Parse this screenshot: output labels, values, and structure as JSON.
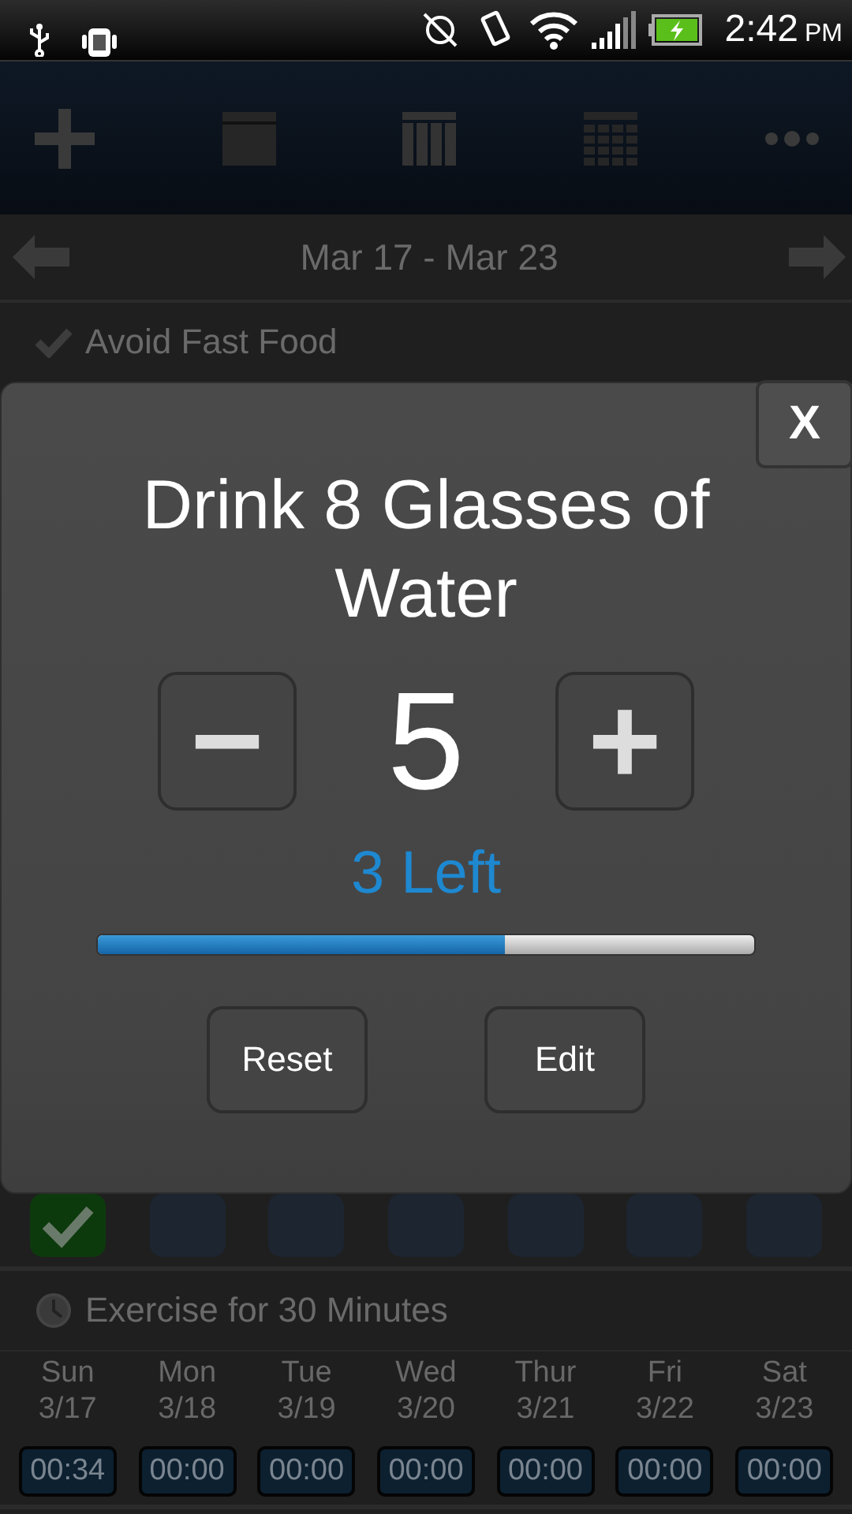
{
  "status_bar": {
    "time": "2:42",
    "ampm": "PM"
  },
  "date_nav": {
    "range": "Mar 17 - Mar 23"
  },
  "habits": [
    {
      "kind": "check",
      "title": "Avoid Fast Food",
      "days": [
        {
          "checked": true
        },
        {
          "checked": false
        },
        {
          "checked": false
        },
        {
          "checked": false
        },
        {
          "checked": false
        },
        {
          "checked": false
        },
        {
          "checked": false
        }
      ]
    },
    {
      "kind": "timer",
      "title": "Exercise for 30 Minutes",
      "days": [
        {
          "day": "Sun",
          "date": "3/17",
          "time": "00:34"
        },
        {
          "day": "Mon",
          "date": "3/18",
          "time": "00:00"
        },
        {
          "day": "Tue",
          "date": "3/19",
          "time": "00:00"
        },
        {
          "day": "Wed",
          "date": "3/20",
          "time": "00:00"
        },
        {
          "day": "Thur",
          "date": "3/21",
          "time": "00:00"
        },
        {
          "day": "Fri",
          "date": "3/22",
          "time": "00:00"
        },
        {
          "day": "Sat",
          "date": "3/23",
          "time": "00:00"
        }
      ]
    }
  ],
  "dialog": {
    "close": "X",
    "title": "Drink 8 Glasses of Water",
    "minus": "−",
    "count": "5",
    "plus": "+",
    "remaining": "3 Left",
    "level": 0.62,
    "buttons": [
      "Reset",
      "Edit"
    ]
  }
}
